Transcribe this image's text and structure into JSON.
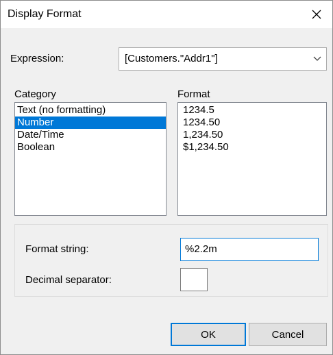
{
  "window": {
    "title": "Display Format",
    "close_icon": "close-icon"
  },
  "expression": {
    "label": "Expression:",
    "value": "[Customers.\"Addr1\"]"
  },
  "category": {
    "label": "Category",
    "items": [
      "Text (no formatting)",
      "Number",
      "Date/Time",
      "Boolean"
    ],
    "selected": "Number"
  },
  "format": {
    "label": "Format",
    "items": [
      "1234.5",
      "1234.50",
      "1,234.50",
      "$1,234.50"
    ]
  },
  "format_string": {
    "label": "Format string:",
    "value": "%2.2m"
  },
  "decimal_separator": {
    "label": "Decimal separator:",
    "value": ""
  },
  "buttons": {
    "ok": "OK",
    "cancel": "Cancel"
  },
  "colors": {
    "selection": "#0078d7",
    "dialog_bg": "#f0f0f0",
    "default_button_border": "#0078d7"
  }
}
